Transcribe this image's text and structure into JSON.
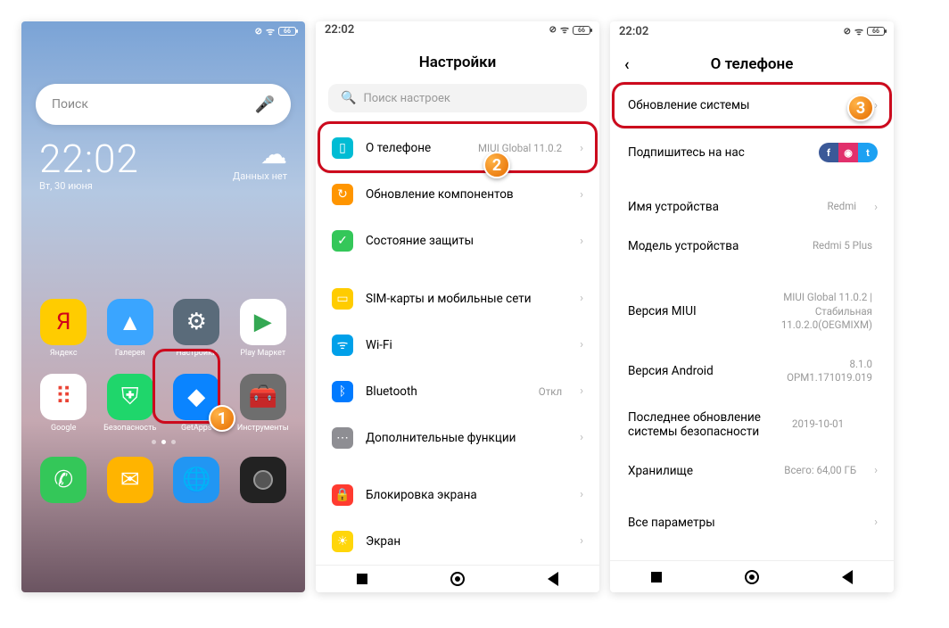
{
  "home": {
    "status": {
      "battery": "66"
    },
    "search_placeholder": "Поиск",
    "clock": {
      "time": "22:02",
      "date": "Вт, 30 июня"
    },
    "weather": "Данных нет",
    "apps": [
      {
        "label": "Яндекс",
        "bg": "#ffcc00",
        "sym": "Я",
        "fg": "#d0021b"
      },
      {
        "label": "Галерея",
        "bg": "#3aa5ff",
        "sym": "▲"
      },
      {
        "label": "Настройки",
        "bg": "#5a6b7a",
        "sym": "⚙"
      },
      {
        "label": "Play Маркет",
        "bg": "#ffffff",
        "sym": "▶",
        "fg": "#34a853"
      },
      {
        "label": "Google",
        "bg": "#ffffff",
        "sym": "⠿",
        "fg": "#ea4335"
      },
      {
        "label": "Безопасность",
        "bg": "#1fd66b",
        "sym": "⛨"
      },
      {
        "label": "GetApps",
        "bg": "#0a84ff",
        "sym": "◆"
      },
      {
        "label": "Инструменты",
        "bg": "#6e6e6e",
        "sym": "🧰"
      }
    ],
    "bubble": "1"
  },
  "settings": {
    "status_time": "22:02",
    "status_battery": "66",
    "title": "Настройки",
    "search_placeholder": "Поиск настроек",
    "about_phone": {
      "label": "О телефоне",
      "value": "MIUI Global 11.0.2"
    },
    "bubble": "2",
    "items": [
      {
        "label": "Обновление компонентов",
        "bg": "#ff9500",
        "sym": "↻"
      },
      {
        "label": "Состояние защиты",
        "bg": "#34c759",
        "sym": "✓"
      }
    ],
    "items2": [
      {
        "label": "SIM-карты и мобильные сети",
        "bg": "#ffcc00",
        "sym": "▭"
      },
      {
        "label": "Wi-Fi",
        "value": "",
        "bg": "#00a0e9",
        "sym": "ᯤ"
      },
      {
        "label": "Bluetooth",
        "value": "Откл",
        "bg": "#007aff",
        "sym": "ᛒ"
      },
      {
        "label": "Дополнительные функции",
        "bg": "#8e8e93",
        "sym": "⋯"
      }
    ],
    "items3": [
      {
        "label": "Блокировка экрана",
        "bg": "#ff3b30",
        "sym": "🔒"
      },
      {
        "label": "Экран",
        "bg": "#ffd60a",
        "sym": "☀"
      }
    ]
  },
  "about": {
    "status_time": "22:02",
    "status_battery": "66",
    "title": "О телефоне",
    "system_update": "Обновление системы",
    "bubble": "3",
    "subscribe": "Подпишитесь на нас",
    "rows": [
      {
        "label": "Имя устройства",
        "value": "Redmi"
      },
      {
        "label": "Модель устройства",
        "value": "Redmi 5 Plus"
      },
      {
        "label": "Версия MIUI",
        "value": "MIUI Global 11.0.2 | Стабильная\n11.0.2.0(OEGMIXM)"
      },
      {
        "label": "Версия Android",
        "value": "8.1.0\nOPM1.171019.019"
      },
      {
        "label": "Последнее обновление системы безопасности",
        "value": "2019-10-01"
      },
      {
        "label": "Хранилище",
        "value": "Всего: 64,00 ГБ"
      },
      {
        "label": "Все параметры",
        "value": ""
      }
    ]
  }
}
